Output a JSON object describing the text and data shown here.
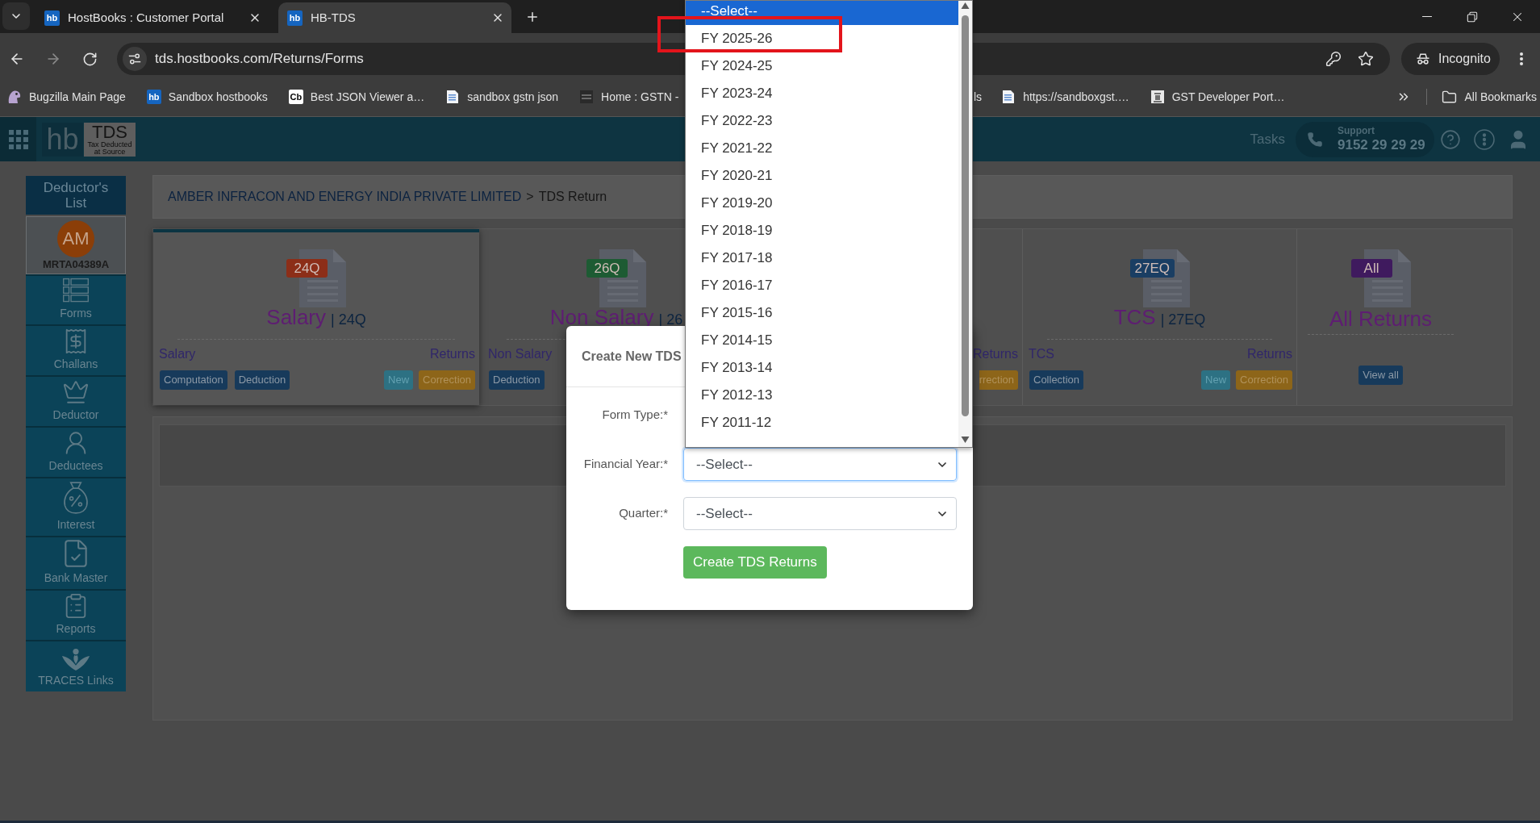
{
  "browser": {
    "tabs": [
      {
        "favicon": "hb",
        "title": "HostBooks : Customer Portal",
        "selected": false
      },
      {
        "favicon": "hb",
        "title": "HB-TDS",
        "selected": true
      }
    ],
    "forward_disabled": true,
    "url": "tds.hostbooks.com/Returns/Forms",
    "profile": "Incognito",
    "bookmarks": [
      {
        "kind": "mascot",
        "label": "Bugzilla Main Page"
      },
      {
        "kind": "logo",
        "logo": "hb",
        "label": "Sandbox hostbooks"
      },
      {
        "kind": "logo_light",
        "logo": "Cb",
        "label": "Best JSON Viewer a…"
      },
      {
        "kind": "document",
        "label": "sandbox gstn json"
      },
      {
        "kind": "grid",
        "label": "Home : GSTN -"
      }
    ],
    "bookmarks_right": [
      {
        "kind": "covered",
        "label": "ls"
      },
      {
        "kind": "document",
        "label": "https://sandboxgst.…"
      },
      {
        "kind": "emblem",
        "label": "GST Developer Port…"
      }
    ],
    "all_bookmarks": "All Bookmarks"
  },
  "app": {
    "logo": {
      "mark": "hb",
      "product": "TDS",
      "tagline": "Tax Deducted at Source"
    },
    "tasks": "Tasks",
    "support": {
      "label": "Support",
      "phone": "9152 29 29 29"
    }
  },
  "sidebar": {
    "title": "Deductor's List",
    "deductor": {
      "initials": "AM",
      "code": "MRTA04389A"
    },
    "items": [
      {
        "kind": "forms",
        "label": "Forms"
      },
      {
        "kind": "challans",
        "label": "Challans"
      },
      {
        "kind": "deductor",
        "label": "Deductor"
      },
      {
        "kind": "deductees",
        "label": "Deductees"
      },
      {
        "kind": "interest",
        "label": "Interest"
      },
      {
        "kind": "bank",
        "label": "Bank Master"
      },
      {
        "kind": "reports",
        "label": "Reports"
      },
      {
        "kind": "traces",
        "label": "TRACES Links"
      }
    ]
  },
  "breadcrumb": {
    "company": "AMBER INFRACON AND ENERGY INDIA PRIVATE LIMITED",
    "separator": ">",
    "page": "TDS Return"
  },
  "cards": [
    {
      "kind": "form",
      "selected": true,
      "badge": "24Q",
      "color": "#8c2e18",
      "title": "Salary",
      "suffix": "| 24Q",
      "left_label": "Salary",
      "right_label": "Returns",
      "left_buttons": [
        "Computation",
        "Deduction"
      ],
      "right_buttons": [
        {
          "kind": "new",
          "label": "New"
        },
        {
          "kind": "correction",
          "label": "Correction"
        }
      ]
    },
    {
      "kind": "form",
      "selected": false,
      "badge": "26Q",
      "color": "#1d5b33",
      "title": "Non Salary",
      "suffix": "| 26",
      "left_label": "Non Salary",
      "left_buttons": [
        "Deduction"
      ]
    },
    {
      "kind": "partial",
      "selected": false,
      "right_label": "Returns",
      "right_buttons": [
        {
          "kind": "correction",
          "label": "rrection"
        }
      ]
    },
    {
      "kind": "form",
      "selected": false,
      "badge": "27EQ",
      "color": "#1a3e63",
      "title": "TCS",
      "suffix": "| 27EQ",
      "left_label": "TCS",
      "right_label": "Returns",
      "left_buttons": [
        "Collection"
      ],
      "right_buttons": [
        {
          "kind": "new",
          "label": "New"
        },
        {
          "kind": "correction",
          "label": "Correction"
        }
      ]
    },
    {
      "kind": "all",
      "selected": false,
      "badge": "All",
      "color": "#3f1a5e",
      "title": "All Returns",
      "button": "View all"
    }
  ],
  "modal": {
    "title": "Create New TDS",
    "fields": [
      {
        "kind": "covered",
        "label": "Form Type:*"
      },
      {
        "kind": "select",
        "label": "Financial Year:*",
        "value": "--Select--",
        "focused": true
      },
      {
        "kind": "select",
        "label": "Quarter:*",
        "value": "--Select--",
        "focused": false
      }
    ],
    "submit": "Create TDS Returns"
  },
  "dropdown": {
    "options": [
      {
        "label": "--Select--",
        "selected": true,
        "highlighted": false
      },
      {
        "label": "FY 2025-26",
        "selected": false,
        "highlighted": true
      },
      {
        "label": "FY 2024-25",
        "selected": false,
        "highlighted": false
      },
      {
        "label": "FY 2023-24",
        "selected": false,
        "highlighted": false
      },
      {
        "label": "FY 2022-23",
        "selected": false,
        "highlighted": false
      },
      {
        "label": "FY 2021-22",
        "selected": false,
        "highlighted": false
      },
      {
        "label": "FY 2020-21",
        "selected": false,
        "highlighted": false
      },
      {
        "label": "FY 2019-20",
        "selected": false,
        "highlighted": false
      },
      {
        "label": "FY 2018-19",
        "selected": false,
        "highlighted": false
      },
      {
        "label": "FY 2017-18",
        "selected": false,
        "highlighted": false
      },
      {
        "label": "FY 2016-17",
        "selected": false,
        "highlighted": false
      },
      {
        "label": "FY 2015-16",
        "selected": false,
        "highlighted": false
      },
      {
        "label": "FY 2014-15",
        "selected": false,
        "highlighted": false
      },
      {
        "label": "FY 2013-14",
        "selected": false,
        "highlighted": false
      },
      {
        "label": "FY 2012-13",
        "selected": false,
        "highlighted": false
      },
      {
        "label": "FY 2011-12",
        "selected": false,
        "highlighted": false
      }
    ]
  }
}
